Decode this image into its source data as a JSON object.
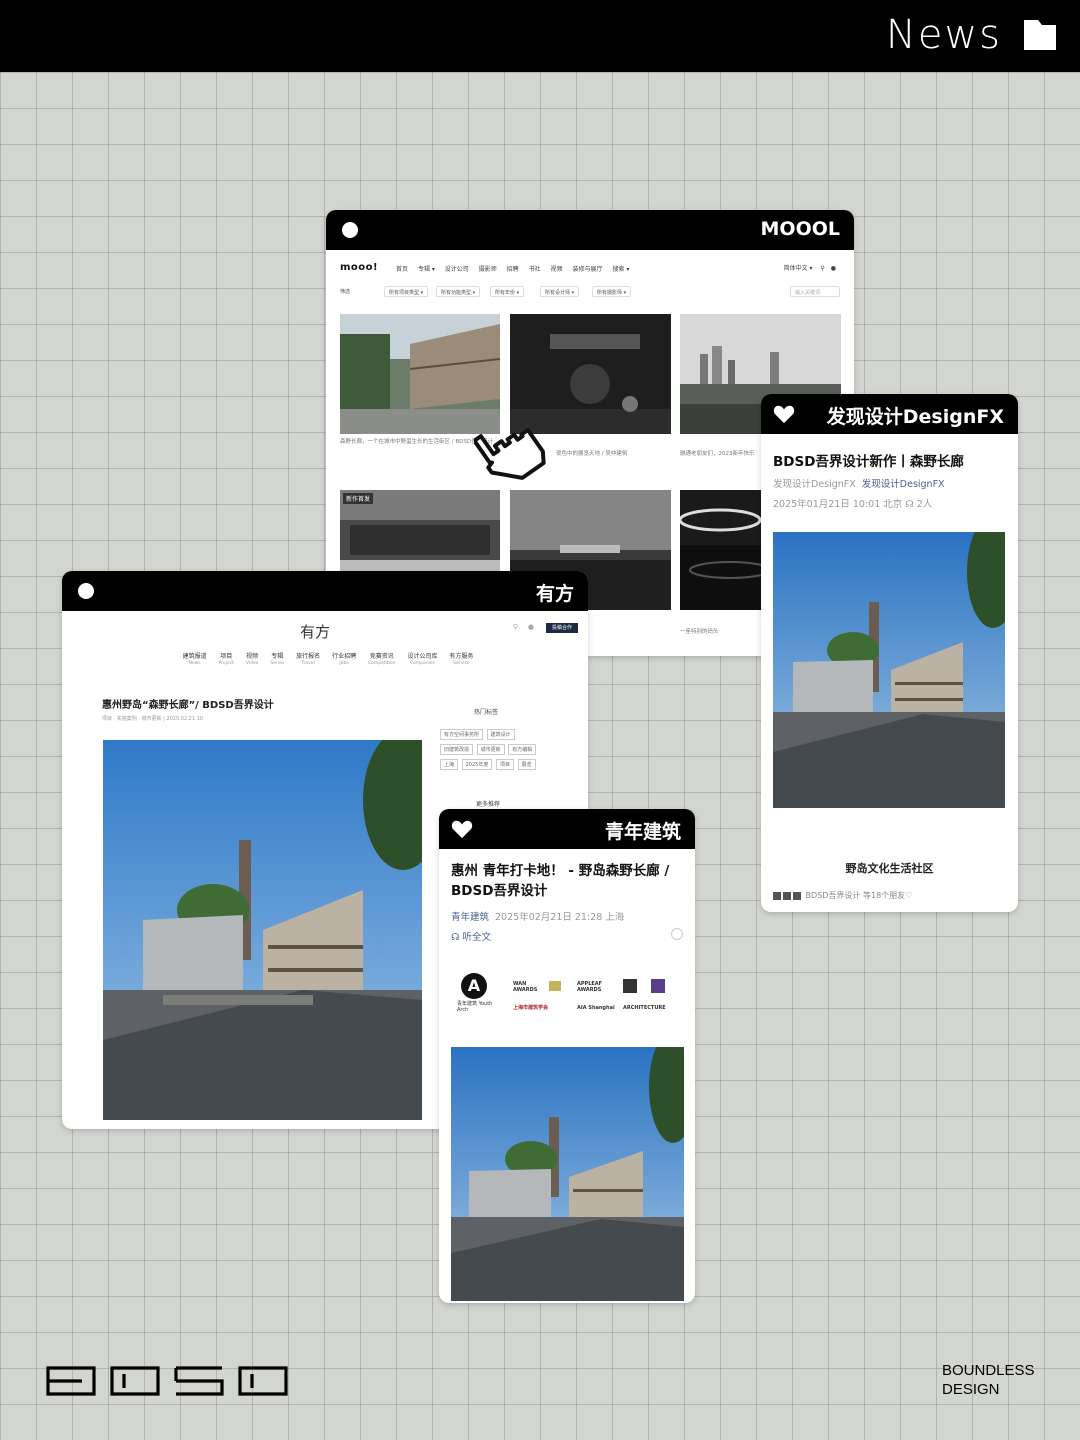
{
  "header": {
    "title": "News"
  },
  "mool": {
    "window_title": "MOOOL",
    "logo": "mooo!",
    "nav_links": [
      "首页",
      "专辑 ▾",
      "设计公司",
      "摄影师",
      "招聘",
      "书社",
      "视频",
      "装修与展厅",
      "搜索 ▾"
    ],
    "nav_right": "简体中文 ▾",
    "filter_label": "筛选",
    "filters": [
      "所有项目类型 ▾",
      "所有功能类型 ▾",
      "所有年份 ▾",
      "所有设计师 ▾",
      "所有摄影师 ▾"
    ],
    "search_placeholder": "输入关键词",
    "captions": [
      "森野长廊，一个在城市中野蛮生长的生活街区 / BDSD吾界设计",
      "夜色中的展览天地 / 吴仲建筑",
      "融通老朋友们，2023新年快乐"
    ],
    "badge": "新作首发",
    "caption_last": "一座特别的码头"
  },
  "youfang": {
    "window_title": "有方",
    "logo": "有方",
    "button": "投稿合作",
    "nav": [
      {
        "zh": "建筑报道",
        "en": "News"
      },
      {
        "zh": "项目",
        "en": "Project"
      },
      {
        "zh": "视频",
        "en": "Video"
      },
      {
        "zh": "专辑",
        "en": "Series"
      },
      {
        "zh": "旅行报名",
        "en": "Travel"
      },
      {
        "zh": "行业招聘",
        "en": "Jobs"
      },
      {
        "zh": "竞赛资讯",
        "en": "Competition"
      },
      {
        "zh": "设计公司库",
        "en": "Companies"
      },
      {
        "zh": "有方服务",
        "en": "Service"
      }
    ],
    "article_title": "惠州野岛“森野长廊”/ BDSD吾界设计",
    "article_meta": "项目  ·  实施案例  ·  城市更新  |  2025.02.21 10",
    "sidebar_title": "热门标签",
    "tags": [
      "有方空间事务所",
      "建筑设计",
      "旧建筑改造",
      "城市更新",
      "有方编辑",
      "上海",
      "2025年度",
      "项目",
      "展览"
    ],
    "sidebar_title2": "更多推荐"
  },
  "designfx": {
    "window_title": "发现设计DesignFX",
    "article_title": "BDSD吾界设计新作丨森野长廊",
    "source": "发现设计DesignFX",
    "source_link": "发现设计DesignFX",
    "meta": "2025年01月21日 10:01  北京   ☊ 2人",
    "caption": "野岛文化生活社区",
    "footer": "BDSD吾界设计 等18个朋友♡"
  },
  "qnjz": {
    "window_title": "青年建筑",
    "article_title": "惠州 青年打卡地！ - 野岛森野长廊 / BDSD吾界设计",
    "source": "青年建筑",
    "meta": "2025年02月21日 21:28  上海",
    "listen": "☊ 听全文",
    "logo_text": "青年建筑 Youth Arch",
    "awards": [
      "WAN AWARDS",
      "APPLEAF AWARDS",
      "上海市建筑学会",
      "AIA Shanghai",
      "ARCHITECTURE"
    ]
  },
  "brand": {
    "line1": "BOUNDLESS",
    "line2": "DESIGN"
  }
}
